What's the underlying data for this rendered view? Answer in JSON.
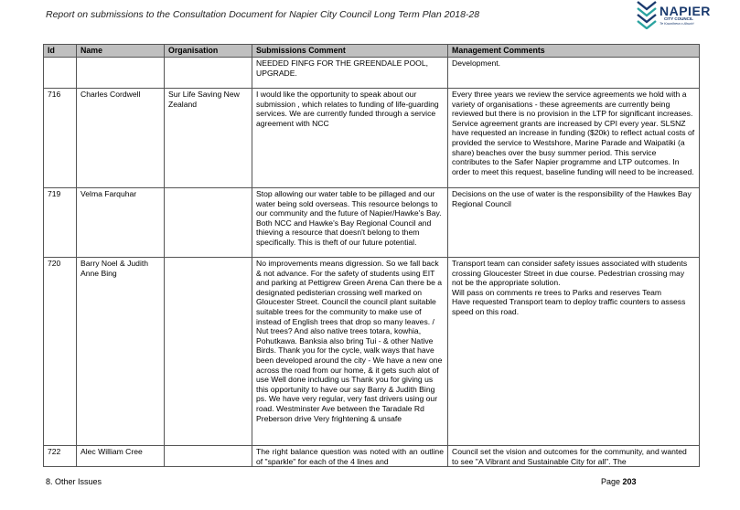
{
  "header": {
    "title": "Report on submissions to the Consultation Document for Napier City Council Long Term Plan 2018-28",
    "logo_name": "NAPIER",
    "logo_sub1": "CITY COUNCIL",
    "logo_sub2": "Te Kaunihera o Ahuriri"
  },
  "table": {
    "columns": [
      "Id",
      "Name",
      "Organisation",
      "Submissions Comment",
      "Management Comments"
    ],
    "rows": [
      {
        "id": "",
        "name": "",
        "organisation": "",
        "submission": "NEEDED FINFG FOR THE GREENDALE POOL, UPGRADE.",
        "management": "Development."
      },
      {
        "id": "716",
        "name": "Charles Cordwell",
        "organisation": "Sur Life Saving New Zealand",
        "submission": "I would like the opportunity  to  speak about our submission , which relates to funding of life-guarding services. We are currently funded through a service agreement  with NCC",
        "management": "Every three years we review the service agreements we hold with a variety of organisations - these agreements are currently being reviewed but there is no provision in the LTP for significant increases.  Service agreement grants are increased by CPI every year.  SLSNZ have requested an increase in funding ($20k) to reflect actual costs of provided the service to Westshore, Marine Parade and Waipatiki (a share) beaches over the busy summer period.  This service contributes to the Safer Napier programme and LTP outcomes.  In order to meet this request, baseline funding will need to be increased."
      },
      {
        "id": "719",
        "name": "Velma Farquhar",
        "organisation": "",
        "submission": "Stop allowing our water table to be pillaged and our water being sold overseas. This resource belongs to our community and the future of Napier/Hawke's Bay. Both NCC and Hawke's Bay Regional Council and thieving a resource that doesn't belong to them specifically. This is theft of our future potential.",
        "management": "Decisions on the use of water is the responsibility of the Hawkes Bay Regional Council"
      },
      {
        "id": "720",
        "name": "Barry Noel & Judith Anne Bing",
        "organisation": "",
        "submission": "No improvements means digression. So we fall back & not advance. For the safety of students using EIT and parking at Pettigrew Green Arena Can there be a designated pedisterian crossing well marked on Gloucester Street. Council the council plant suitable suitable trees for the community to make use of instead of English trees that drop so many leaves. / Nut trees? And also native trees totara, kowhia, Pohutkawa. Banksia also bring Tui - & other Native Birds. Thank you for the cycle, walk ways that have been developed around the city - We have a new one across the road from our home, & it gets such alot of use  Well done including us Thank you for giving us this opportunity to have our say Barry & Judith Bing ps. We have very regular, very fast drivers using our road. Westminster Ave between the Taradale Rd Preberson drive Very frightening & unsafe",
        "management": "Transport team can consider safety issues associated with students crossing Gloucester Street in due course. Pedestrian crossing may not be the appropriate solution.\nWill pass on comments re trees to Parks and reserves Team\nHave requested Transport team to deploy traffic counters to assess speed on this road."
      },
      {
        "id": "722",
        "name": "Alec William Cree",
        "organisation": "",
        "submission": "The  right  balance  question  was  noted  with  an outline  of  \"sparkle\"  for  each  of  the  4  lines  and",
        "management": "Council set the vision and outcomes for the community, and wanted to see \"A Vibrant and Sustainable City for all\".  The"
      }
    ]
  },
  "footer": {
    "section": "8. Other Issues",
    "page_label": "Page",
    "page_number": "203"
  }
}
